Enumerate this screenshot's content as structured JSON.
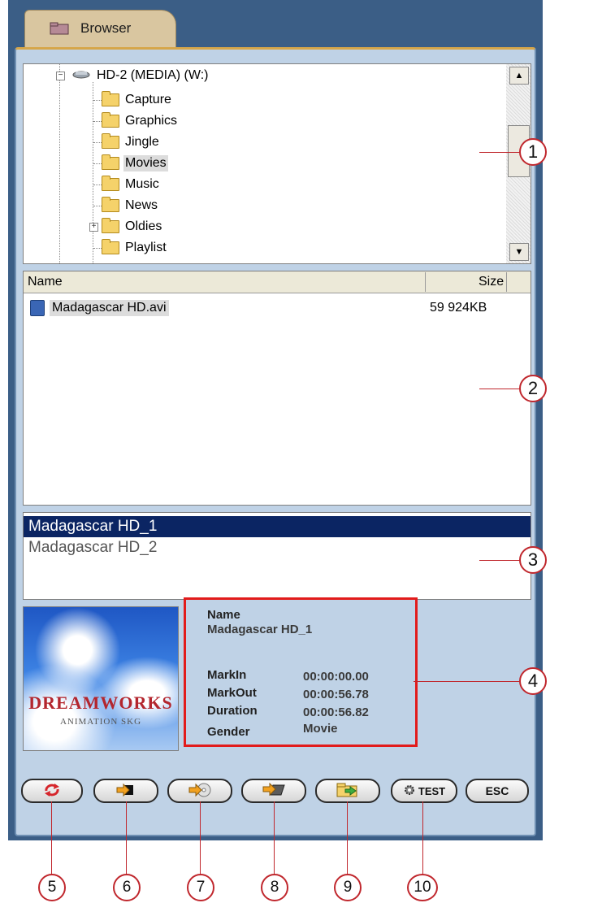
{
  "tab": {
    "label": "Browser",
    "icon": "folder-icon"
  },
  "tree": {
    "drive": "HD-2 (MEDIA) (W:)",
    "folders": [
      "Capture",
      "Graphics",
      "Jingle",
      "Movies",
      "Music",
      "News",
      "Oldies",
      "Playlist"
    ],
    "selected": "Movies",
    "expandable": "Oldies"
  },
  "file_list": {
    "columns": [
      "Name",
      "Size"
    ],
    "rows": [
      {
        "name": "Madagascar HD.avi",
        "size": "59 924KB"
      }
    ]
  },
  "clips": {
    "items": [
      "Madagascar HD_1",
      "Madagascar HD_2"
    ],
    "selected": "Madagascar HD_1"
  },
  "thumbnail": {
    "logo_line1": "DREAMWORKS",
    "logo_line2": "ANIMATION SKG"
  },
  "info": {
    "name_label": "Name",
    "name_value": "Madagascar HD_1",
    "markin_label": "MarkIn",
    "markin_value": "00:00:00.00",
    "markout_label": "MarkOut",
    "markout_value": "00:00:56.78",
    "duration_label": "Duration",
    "duration_value": "00:00:56.82",
    "gender_label": "Gender",
    "gender_value": "Movie"
  },
  "buttons": [
    {
      "icon": "refresh-icon",
      "label": ""
    },
    {
      "icon": "arrow-right-icon",
      "label": ""
    },
    {
      "icon": "arrow-disc-icon",
      "label": ""
    },
    {
      "icon": "arrow-tape-icon",
      "label": ""
    },
    {
      "icon": "folder-arrow-icon",
      "label": ""
    },
    {
      "icon": "gear-icon",
      "label": "TEST"
    },
    {
      "icon": "",
      "label": "ESC"
    }
  ],
  "callouts": [
    "1",
    "2",
    "3",
    "4",
    "5",
    "6",
    "7",
    "8",
    "9",
    "10"
  ],
  "colors": {
    "accent": "#c0272d",
    "selection": "#0b2563",
    "panel": "#bfd2e6",
    "frame": "#3b5e86"
  }
}
